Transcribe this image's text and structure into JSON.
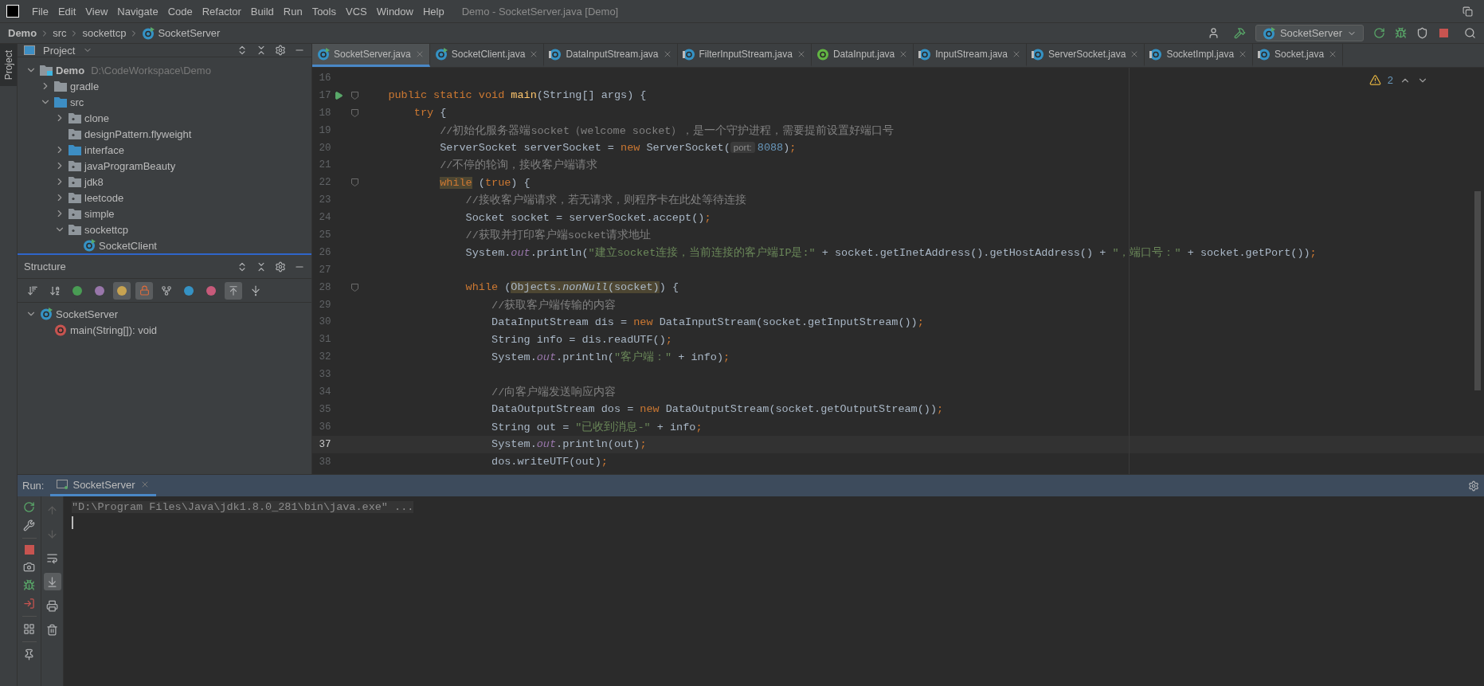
{
  "window": {
    "title": "Demo - SocketServer.java [Demo]"
  },
  "menu": [
    "File",
    "Edit",
    "View",
    "Navigate",
    "Code",
    "Refactor",
    "Build",
    "Run",
    "Tools",
    "VCS",
    "Window",
    "Help"
  ],
  "breadcrumbs": [
    "Demo",
    "src",
    "sockettcp",
    "SocketServer"
  ],
  "toolbar": {
    "run_config": "SocketServer"
  },
  "side_tabs": [
    {
      "label": "Project",
      "selected": true
    }
  ],
  "project": {
    "title": "Project",
    "tree": [
      {
        "label": "Demo",
        "kind": "module",
        "hint": "D:\\CodeWorkspace\\Demo",
        "expanded": true,
        "children": [
          {
            "label": "gradle",
            "kind": "folder",
            "expanded": false
          },
          {
            "label": "src",
            "kind": "source-folder",
            "expanded": true,
            "children": [
              {
                "label": "clone",
                "kind": "package",
                "expanded": false
              },
              {
                "label": "designPattern.flyweight",
                "kind": "package"
              },
              {
                "label": "interface",
                "kind": "source-folder",
                "expanded": false
              },
              {
                "label": "javaProgramBeauty",
                "kind": "package",
                "expanded": false
              },
              {
                "label": "jdk8",
                "kind": "package",
                "expanded": false
              },
              {
                "label": "leetcode",
                "kind": "package",
                "expanded": false
              },
              {
                "label": "simple",
                "kind": "package",
                "expanded": false
              },
              {
                "label": "sockettcp",
                "kind": "package",
                "expanded": true,
                "children": [
                  {
                    "label": "SocketClient",
                    "kind": "class"
                  }
                ]
              }
            ]
          }
        ]
      }
    ]
  },
  "structure": {
    "title": "Structure",
    "toolbar": [
      {
        "kind": "sort-visibility",
        "on": false
      },
      {
        "kind": "sort-alpha",
        "on": false
      },
      {
        "kind": "inherited",
        "on": false
      },
      {
        "kind": "properties",
        "on": false
      },
      {
        "kind": "fields",
        "on": true
      },
      {
        "kind": "non-public",
        "on": true
      },
      {
        "kind": "lambda-tree",
        "on": false
      },
      {
        "kind": "anonymous",
        "on": false
      },
      {
        "kind": "lambdas",
        "on": false
      },
      {
        "kind": "autoscroll-to",
        "on": true
      },
      {
        "kind": "autoscroll-from",
        "on": false
      }
    ],
    "tree": [
      {
        "label": "SocketServer",
        "kind": "class",
        "expanded": true,
        "children": [
          {
            "label": "main(String[]): void",
            "kind": "method"
          }
        ]
      }
    ]
  },
  "editor": {
    "tabs": [
      {
        "label": "SocketServer.java",
        "kind": "class",
        "selected": true
      },
      {
        "label": "SocketClient.java",
        "kind": "class",
        "selected": false
      },
      {
        "label": "DataInputStream.java",
        "kind": "library-class",
        "selected": false
      },
      {
        "label": "FilterInputStream.java",
        "kind": "library-class",
        "selected": false
      },
      {
        "label": "DataInput.java",
        "kind": "interface",
        "selected": false
      },
      {
        "label": "InputStream.java",
        "kind": "library-class",
        "selected": false
      },
      {
        "label": "ServerSocket.java",
        "kind": "library-class",
        "selected": false
      },
      {
        "label": "SocketImpl.java",
        "kind": "library-class",
        "selected": false
      },
      {
        "label": "Socket.java",
        "kind": "library-class",
        "selected": false
      }
    ],
    "warnings": "2",
    "lines": [
      {
        "number": "16",
        "current": false,
        "fold": false,
        "run": false
      },
      {
        "number": "17",
        "current": false,
        "fold": true,
        "run": true,
        "tokens": [
          {
            "kind": "kw",
            "text": "    public static void "
          },
          {
            "kind": "method",
            "text": "main"
          },
          {
            "kind": "plain",
            "text": "(String[] args) {"
          }
        ]
      },
      {
        "number": "18",
        "current": false,
        "fold": true,
        "run": false,
        "tokens": [
          {
            "kind": "kw",
            "text": "        try"
          },
          {
            "kind": "plain",
            "text": " {"
          }
        ]
      },
      {
        "number": "19",
        "current": false,
        "fold": false,
        "run": false,
        "tokens": [
          {
            "kind": "comment",
            "text": "            //初始化服务器端socket（welcome socket），是一个守护进程，需要提前设置好端口号"
          }
        ]
      },
      {
        "number": "20",
        "current": false,
        "fold": false,
        "run": false,
        "tokens": [
          {
            "kind": "plain",
            "text": "            ServerSocket serverSocket = "
          },
          {
            "kind": "kw",
            "text": "new "
          },
          {
            "kind": "plain",
            "text": "ServerSocket("
          },
          {
            "kind": "hint",
            "text": "port:"
          },
          {
            "kind": "number",
            "text": "8088"
          },
          {
            "kind": "plain",
            "text": ")"
          },
          {
            "kind": "kw",
            "text": ";"
          }
        ]
      },
      {
        "number": "21",
        "current": false,
        "fold": false,
        "run": false,
        "tokens": [
          {
            "kind": "comment",
            "text": "            //不停的轮询，接收客户端请求"
          }
        ]
      },
      {
        "number": "22",
        "current": false,
        "fold": true,
        "run": false,
        "tokens": [
          {
            "kind": "kw-match",
            "text": "            while"
          },
          {
            "kind": "plain",
            "text": " ("
          },
          {
            "kind": "kw",
            "text": "true"
          },
          {
            "kind": "plain",
            "text": ") {"
          }
        ]
      },
      {
        "number": "23",
        "current": false,
        "fold": false,
        "run": false,
        "tokens": [
          {
            "kind": "comment",
            "text": "                //接收客户端请求，若无请求，则程序卡在此处等待连接"
          }
        ]
      },
      {
        "number": "24",
        "current": false,
        "fold": false,
        "run": false,
        "tokens": [
          {
            "kind": "plain",
            "text": "                Socket socket = serverSocket.accept()"
          },
          {
            "kind": "kw",
            "text": ";"
          }
        ]
      },
      {
        "number": "25",
        "current": false,
        "fold": false,
        "run": false,
        "tokens": [
          {
            "kind": "comment",
            "text": "                //获取并打印客户端socket请求地址"
          }
        ]
      },
      {
        "number": "26",
        "current": false,
        "fold": false,
        "run": false,
        "tokens": [
          {
            "kind": "plain",
            "text": "                System."
          },
          {
            "kind": "field",
            "text": "out"
          },
          {
            "kind": "plain",
            "text": ".println("
          },
          {
            "kind": "string",
            "text": "\"建立socket连接，当前连接的客户端IP是:\""
          },
          {
            "kind": "plain",
            "text": " + socket.getInetAddress().getHostAddress() + "
          },
          {
            "kind": "string",
            "text": "\"，端口号：\""
          },
          {
            "kind": "plain",
            "text": " + socket.getPort())"
          },
          {
            "kind": "kw",
            "text": ";"
          }
        ]
      },
      {
        "number": "27",
        "current": false,
        "fold": false,
        "run": false
      },
      {
        "number": "28",
        "current": false,
        "fold": true,
        "run": false,
        "tokens": [
          {
            "kind": "kw",
            "text": "                while"
          },
          {
            "kind": "plain",
            "text": " ("
          },
          {
            "kind": "match",
            "text": "Objects."
          },
          {
            "kind": "match-italic",
            "text": "nonNull"
          },
          {
            "kind": "match",
            "text": "(socket)"
          },
          {
            "kind": "plain",
            "text": ") {"
          }
        ]
      },
      {
        "number": "29",
        "current": false,
        "fold": false,
        "run": false,
        "tokens": [
          {
            "kind": "comment",
            "text": "                    //获取客户端传输的内容"
          }
        ]
      },
      {
        "number": "30",
        "current": false,
        "fold": false,
        "run": false,
        "tokens": [
          {
            "kind": "plain",
            "text": "                    DataInputStream dis = "
          },
          {
            "kind": "kw",
            "text": "new "
          },
          {
            "kind": "plain",
            "text": "DataInputStream(socket.getInputStream())"
          },
          {
            "kind": "kw",
            "text": ";"
          }
        ]
      },
      {
        "number": "31",
        "current": false,
        "fold": false,
        "run": false,
        "tokens": [
          {
            "kind": "plain",
            "text": "                    String info = dis.readUTF()"
          },
          {
            "kind": "kw",
            "text": ";"
          }
        ]
      },
      {
        "number": "32",
        "current": false,
        "fold": false,
        "run": false,
        "tokens": [
          {
            "kind": "plain",
            "text": "                    System."
          },
          {
            "kind": "field",
            "text": "out"
          },
          {
            "kind": "plain",
            "text": ".println("
          },
          {
            "kind": "string",
            "text": "\"客户端：\""
          },
          {
            "kind": "plain",
            "text": " + info)"
          },
          {
            "kind": "kw",
            "text": ";"
          }
        ]
      },
      {
        "number": "33",
        "current": false,
        "fold": false,
        "run": false
      },
      {
        "number": "34",
        "current": false,
        "fold": false,
        "run": false,
        "tokens": [
          {
            "kind": "comment",
            "text": "                    //向客户端发送响应内容"
          }
        ]
      },
      {
        "number": "35",
        "current": false,
        "fold": false,
        "run": false,
        "tokens": [
          {
            "kind": "plain",
            "text": "                    DataOutputStream dos = "
          },
          {
            "kind": "kw",
            "text": "new "
          },
          {
            "kind": "plain",
            "text": "DataOutputStream(socket.getOutputStream())"
          },
          {
            "kind": "kw",
            "text": ";"
          }
        ]
      },
      {
        "number": "36",
        "current": false,
        "fold": false,
        "run": false,
        "tokens": [
          {
            "kind": "plain",
            "text": "                    String out = "
          },
          {
            "kind": "string",
            "text": "\"已收到消息-\""
          },
          {
            "kind": "plain",
            "text": " + info"
          },
          {
            "kind": "kw",
            "text": ";"
          }
        ]
      },
      {
        "number": "37",
        "current": true,
        "fold": false,
        "run": false,
        "tokens": [
          {
            "kind": "plain",
            "text": "                    System."
          },
          {
            "kind": "field",
            "text": "out"
          },
          {
            "kind": "plain",
            "text": ".println(out)"
          },
          {
            "kind": "kw",
            "text": ";"
          }
        ]
      },
      {
        "number": "38",
        "current": false,
        "fold": false,
        "run": false,
        "tokens": [
          {
            "kind": "plain",
            "text": "                    dos.writeUTF(out)"
          },
          {
            "kind": "kw",
            "text": ";"
          }
        ]
      }
    ]
  },
  "run": {
    "label": "Run:",
    "tabs": [
      {
        "label": "SocketServer",
        "selected": true
      }
    ],
    "toolbar": [
      {
        "kind": "up",
        "on": false,
        "disabled": true
      },
      {
        "kind": "down",
        "on": false,
        "disabled": true
      },
      {
        "kind": "wrap",
        "on": false,
        "disabled": false
      },
      {
        "kind": "scroll-end",
        "on": true,
        "disabled": false
      },
      {
        "kind": "print",
        "on": false,
        "disabled": false
      },
      {
        "kind": "trash",
        "on": false,
        "disabled": false
      }
    ],
    "console": [
      "\"D:\\Program Files\\Java\\jdk1.8.0_281\\bin\\java.exe\" ..."
    ]
  }
}
